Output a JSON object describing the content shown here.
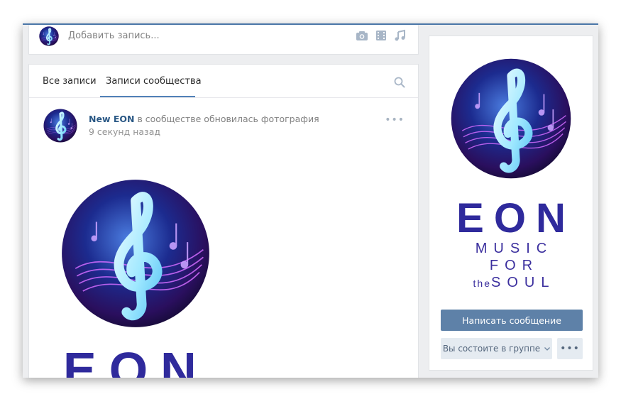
{
  "composer": {
    "placeholder": "Добавить запись...",
    "icons": [
      "camera-icon",
      "video-icon",
      "music-note-icon"
    ]
  },
  "feed": {
    "tabs": [
      {
        "label": "Все записи",
        "active": false
      },
      {
        "label": "Записи сообщества",
        "active": true
      }
    ],
    "post": {
      "author": "New EON",
      "action": " в сообществе обновилась фотография",
      "time": "9 секунд назад",
      "image_logo_text": "EON"
    }
  },
  "sidebar": {
    "logo": {
      "title": "EON",
      "line1": "MUSIC",
      "line2": "FOR",
      "line3_small": "the",
      "line3": "SOUL"
    },
    "message_button": "Написать сообщение",
    "member_button": "Вы состоите в группе",
    "more_button": "•••"
  },
  "colors": {
    "accent": "#5181b8",
    "button": "#5e81a8",
    "logo": "#2f2a9c"
  }
}
